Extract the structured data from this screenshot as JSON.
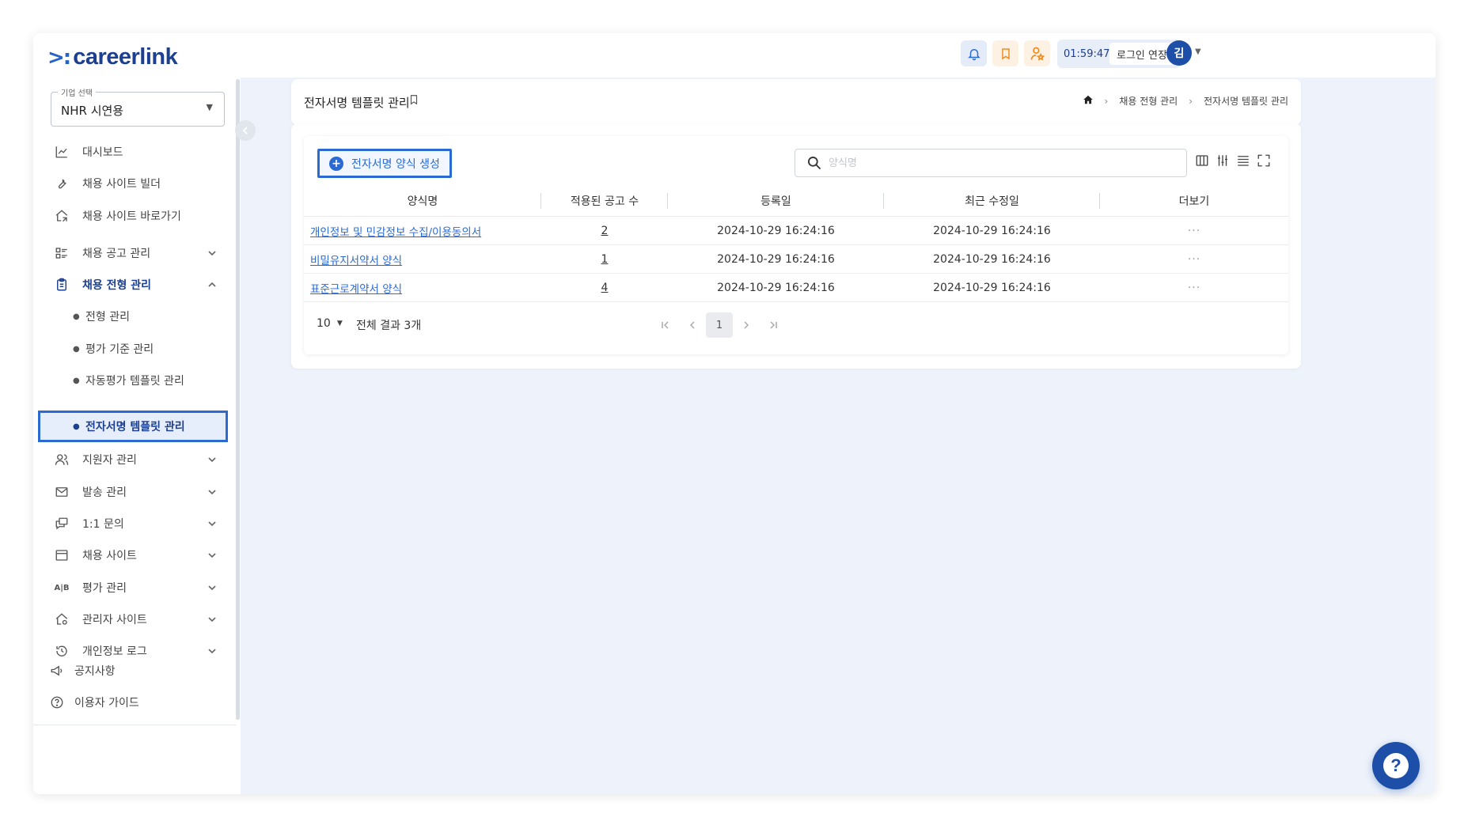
{
  "header": {
    "logo_mark": ">:",
    "logo_text": "careerlink",
    "session_time": "01:59:47",
    "extend_login_label": "로그인 연장",
    "avatar_initial": "김"
  },
  "sidebar": {
    "company_label": "기업 선택",
    "company_value": "NHR 시연용",
    "menu": [
      {
        "label": "대시보드",
        "icon": "chart-icon"
      },
      {
        "label": "채용 사이트 빌더",
        "icon": "wrench-icon"
      },
      {
        "label": "채용 사이트 바로가기",
        "icon": "home-link-icon"
      },
      {
        "label": "채용 공고 관리",
        "icon": "list-icon"
      },
      {
        "label": "채용 전형 관리",
        "icon": "clipboard-icon"
      },
      {
        "label": "지원자 관리",
        "icon": "users-icon"
      },
      {
        "label": "발송 관리",
        "icon": "mail-icon"
      },
      {
        "label": "1:1 문의",
        "icon": "chat-icon"
      },
      {
        "label": "채용 사이트",
        "icon": "window-icon"
      },
      {
        "label": "평가 관리",
        "icon": "ab-icon"
      },
      {
        "label": "관리자 사이트",
        "icon": "admin-home-icon"
      },
      {
        "label": "개인정보 로그",
        "icon": "history-icon"
      }
    ],
    "submenu": [
      {
        "label": "전형 관리"
      },
      {
        "label": "평가 기준 관리"
      },
      {
        "label": "자동평가 템플릿 관리"
      },
      {
        "label": "전자서명 템플릿 관리"
      }
    ],
    "footer": [
      {
        "label": "공지사항",
        "icon": "megaphone-icon"
      },
      {
        "label": "이용자 가이드",
        "icon": "help-circle-icon"
      }
    ]
  },
  "page": {
    "title": "전자서명 템플릿 관리",
    "breadcrumb": [
      "채용 전형 관리",
      "전자서명 템플릿 관리"
    ]
  },
  "toolbar": {
    "create_label": "전자서명 양식 생성",
    "search_placeholder": "양식명"
  },
  "table": {
    "headers": [
      "양식명",
      "적용된 공고 수",
      "등록일",
      "최근 수정일",
      "더보기"
    ],
    "rows": [
      {
        "name": "개인정보 및 민감정보 수집/이용동의서",
        "count": "2",
        "created": "2024-10-29 16:24:16",
        "modified": "2024-10-29 16:24:16",
        "more": "···"
      },
      {
        "name": "비밀유지서약서 양식",
        "count": "1",
        "created": "2024-10-29 16:24:16",
        "modified": "2024-10-29 16:24:16",
        "more": "···"
      },
      {
        "name": "표준근로계약서 양식",
        "count": "4",
        "created": "2024-10-29 16:24:16",
        "modified": "2024-10-29 16:24:16",
        "more": "···"
      }
    ]
  },
  "pagination": {
    "page_size": "10",
    "total_text": "전체 결과 3개",
    "current_page": "1"
  },
  "colors": {
    "brand": "#1d3f8f",
    "accent": "#2b6ad3",
    "background": "#eef3fb"
  }
}
